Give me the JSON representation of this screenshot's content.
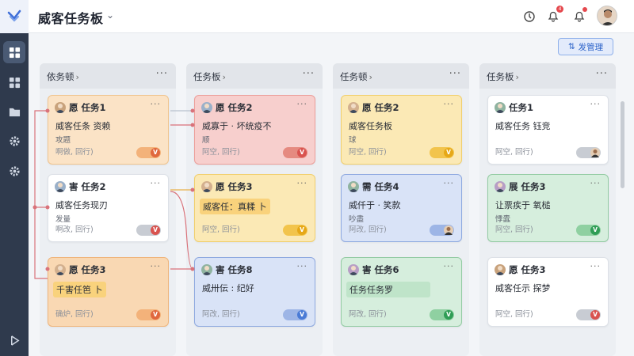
{
  "app": {
    "title": "威客任务板",
    "notification_count": "4"
  },
  "sidebar": {
    "items": [
      {
        "icon": "board-icon",
        "active": true
      },
      {
        "icon": "grid-icon",
        "active": false
      },
      {
        "icon": "folder-icon",
        "active": false
      },
      {
        "icon": "gear-icon",
        "active": false
      },
      {
        "icon": "settings-icon",
        "active": false
      },
      {
        "icon": "collapse-icon",
        "active": false
      }
    ]
  },
  "toolbar": {
    "manage_label": "发管理",
    "manage_icon": "swap-icon"
  },
  "columns": [
    {
      "title": "依务顿",
      "cards": [
        {
          "head": "愿 任务1",
          "title": "威客任条 资赖",
          "sub": "攻题",
          "foot": "啊做, 回行)",
          "toggle": "V",
          "color": "orange"
        },
        {
          "head": "害 任务2",
          "title": "威客任务现刃",
          "sub": "发量",
          "foot": "啊改, 回行)",
          "toggle": "V",
          "color": "white"
        },
        {
          "head": "愿 任务3",
          "title": "千害任笆 卜",
          "sub": "",
          "foot": "确炉, 回行)",
          "toggle": "V",
          "color": "orange2"
        }
      ]
    },
    {
      "title": "任务板",
      "cards": [
        {
          "head": "愿 任务2",
          "title": "威寡于 · 坏统疫不",
          "sub": "顺",
          "foot": "阿空, 回行)",
          "toggle": "V",
          "color": "red"
        },
        {
          "head": "愿 任务3",
          "title": "威客任：真糅 卜",
          "sub": "",
          "foot": "阿空, 回行)",
          "toggle": "V",
          "color": "yellow"
        },
        {
          "head": "害 任务8",
          "title": "威卅伝 : 纪好",
          "sub": "",
          "foot": "阿改, 回行)",
          "toggle": "V",
          "color": "blue"
        }
      ]
    },
    {
      "title": "任务顿",
      "cards": [
        {
          "head": "愿 任务2",
          "title": "威客任务板",
          "sub": "球",
          "foot": "阿空, 回行)",
          "toggle": "V",
          "color": "yellow"
        },
        {
          "head": "需 任务4",
          "title": "威仟于 · 笑款",
          "sub": "吵盡",
          "foot": "阿改, 回行)",
          "toggle": "avatar",
          "color": "blue"
        },
        {
          "head": "害 任务6",
          "title": "任务任务罗",
          "sub": "",
          "foot": "阿改, 回行)",
          "toggle": "V",
          "color": "green"
        }
      ]
    },
    {
      "title": "任务板",
      "cards": [
        {
          "head": "任务1",
          "title": "威客任务 钰竞",
          "sub": "",
          "foot": "阿空, 回行)",
          "toggle": "avatar",
          "color": "white"
        },
        {
          "head": "展 任务3",
          "title": "让票疾于 氧槌",
          "sub": "悸蠹",
          "foot": "阿空, 回行)",
          "toggle": "V",
          "color": "green"
        },
        {
          "head": "愿 任务3",
          "title": "威客任示 探梦",
          "sub": "",
          "foot": "阿空, 回行)",
          "toggle": "V",
          "color": "white"
        }
      ]
    }
  ],
  "colors": {
    "orange": "#fbe3c6",
    "orange2": "#f9d8b3",
    "red": "#f7cfcd",
    "yellow": "#fbe9b5",
    "blue": "#d9e3f7",
    "green": "#d6eedd",
    "white": "#ffffff",
    "accent": "#2c63c9"
  }
}
